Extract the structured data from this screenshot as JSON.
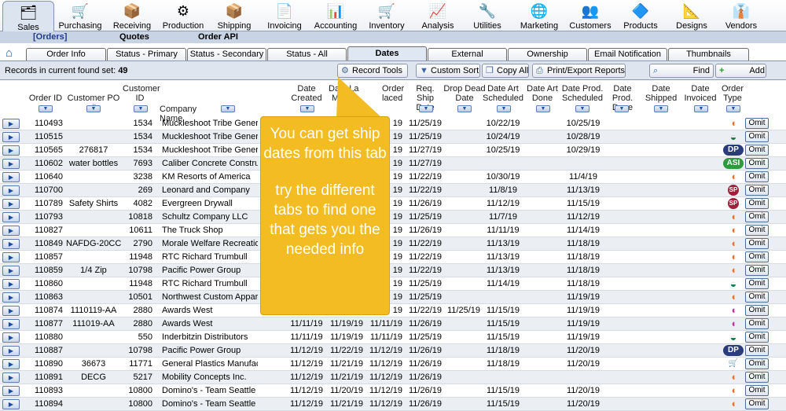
{
  "modules": [
    {
      "label": "Sales",
      "icon": "sales-icon",
      "glyph": "🗂"
    },
    {
      "label": "Purchasing",
      "icon": "purchasing-icon",
      "glyph": "🛒"
    },
    {
      "label": "Receiving",
      "icon": "receiving-icon",
      "glyph": "📦"
    },
    {
      "label": "Production",
      "icon": "production-icon",
      "glyph": "⚙"
    },
    {
      "label": "Shipping",
      "icon": "shipping-icon",
      "glyph": "📦"
    },
    {
      "label": "Invoicing",
      "icon": "invoicing-icon",
      "glyph": "📄"
    },
    {
      "label": "Accounting",
      "icon": "accounting-icon",
      "glyph": "📊"
    },
    {
      "label": "Inventory",
      "icon": "inventory-icon",
      "glyph": "🛒"
    },
    {
      "label": "Analysis",
      "icon": "analysis-icon",
      "glyph": "📈"
    },
    {
      "label": "Utilities",
      "icon": "utilities-icon",
      "glyph": "🔧"
    },
    {
      "label": "Marketing",
      "icon": "marketing-icon",
      "glyph": "🌐"
    },
    {
      "label": "Customers",
      "icon": "customers-icon",
      "glyph": "👥"
    },
    {
      "label": "Products",
      "icon": "products-icon",
      "glyph": "🔷"
    },
    {
      "label": "Designs",
      "icon": "designs-icon",
      "glyph": "📐"
    },
    {
      "label": "Vendors",
      "icon": "vendors-icon",
      "glyph": "👔"
    }
  ],
  "submenu": {
    "orders": "[Orders]",
    "quotes": "Quotes",
    "order_api": "Order API"
  },
  "tabs": [
    "Order Info",
    "Status - Primary",
    "Status - Secondary",
    "Status - All",
    "Dates",
    "External",
    "Ownership",
    "Email Notification",
    "Thumbnails"
  ],
  "records": {
    "label": "Records in current found set:",
    "count": "49"
  },
  "toolbar": {
    "record_tools": "Record Tools",
    "custom_sort": "Custom Sort",
    "copy_all": "Copy All",
    "print_export": "Print/Export Reports",
    "find": "Find",
    "add": "Add"
  },
  "columns": {
    "order_id": "Order ID",
    "customer_po": "Customer PO #",
    "customer_id_1": "Customer",
    "customer_id_2": "ID",
    "company_name": "Company Name",
    "date_created_1": "Date",
    "date_created_2": "Created",
    "last_mod_1": "Date La",
    "last_mod_2": "Modi",
    "order_placed_1": "Order",
    "order_placed_2": "laced",
    "req_ship_1": "Req. Ship",
    "req_ship_2": "Date",
    "drop_dead_1": "Drop Dead",
    "drop_dead_2": "Date",
    "art_sched_1": "Date Art",
    "art_sched_2": "Scheduled",
    "art_done_1": "Date Art",
    "art_done_2": "Done",
    "prod_sched_1": "Date Prod.",
    "prod_sched_2": "Scheduled",
    "prod_done_1": "Date Prod.",
    "prod_done_2": "Done",
    "shipped_1": "Date",
    "shipped_2": "Shipped",
    "invoiced_1": "Date",
    "invoiced_2": "Invoiced",
    "type_1": "Order",
    "type_2": "Type"
  },
  "rows": [
    {
      "order": "110493",
      "po": "",
      "cid": "1534",
      "company": "Muckleshoot Tribe General S",
      "created": "",
      "lastmod": "",
      "placed": "19",
      "reqship": "11/25/19",
      "dropdead": "",
      "artsched": "10/22/19",
      "artdone": "",
      "prodsched": "10/25/19",
      "type": "C",
      "type_color": "#e8702a"
    },
    {
      "order": "110515",
      "po": "",
      "cid": "1534",
      "company": "Muckleshoot Tribe General S",
      "created": "",
      "lastmod": "",
      "placed": "19",
      "reqship": "11/25/19",
      "dropdead": "",
      "artsched": "10/24/19",
      "artdone": "",
      "prodsched": "10/28/19",
      "type": "cap",
      "type_color": "#1e7a4a"
    },
    {
      "order": "110565",
      "po": "276817",
      "cid": "1534",
      "company": "Muckleshoot Tribe General S",
      "created": "",
      "lastmod": "",
      "placed": "19",
      "reqship": "11/27/19",
      "dropdead": "",
      "artsched": "10/25/19",
      "artdone": "",
      "prodsched": "10/29/19",
      "type": "DP",
      "type_color": "#2a3c7a"
    },
    {
      "order": "110602",
      "po": "water bottles",
      "cid": "7693",
      "company": "Caliber Concrete Constructio",
      "created": "",
      "lastmod": "",
      "placed": "19",
      "reqship": "11/27/19",
      "dropdead": "",
      "artsched": "",
      "artdone": "",
      "prodsched": "",
      "type": "ASI",
      "type_color": "#2f9a3c"
    },
    {
      "order": "110640",
      "po": "",
      "cid": "3238",
      "company": "KM Resorts of America",
      "created": "",
      "lastmod": "",
      "placed": "19",
      "reqship": "11/22/19",
      "dropdead": "",
      "artsched": "10/30/19",
      "artdone": "",
      "prodsched": "11/4/19",
      "type": "C",
      "type_color": "#e8702a"
    },
    {
      "order": "110700",
      "po": "",
      "cid": "269",
      "company": "Leonard and Company",
      "created": "",
      "lastmod": "",
      "placed": "19",
      "reqship": "11/22/19",
      "dropdead": "",
      "artsched": "11/8/19",
      "artdone": "",
      "prodsched": "11/13/19",
      "type": "SP",
      "type_color": "#a0203a"
    },
    {
      "order": "110789",
      "po": "Safety Shirts",
      "cid": "4082",
      "company": "Evergreen Drywall",
      "created": "",
      "lastmod": "",
      "placed": "19",
      "reqship": "11/26/19",
      "dropdead": "",
      "artsched": "11/12/19",
      "artdone": "",
      "prodsched": "11/15/19",
      "type": "SP",
      "type_color": "#a0203a"
    },
    {
      "order": "110793",
      "po": "",
      "cid": "10818",
      "company": "Schultz Company LLC",
      "created": "",
      "lastmod": "",
      "placed": "19",
      "reqship": "11/25/19",
      "dropdead": "",
      "artsched": "11/7/19",
      "artdone": "",
      "prodsched": "11/12/19",
      "type": "C",
      "type_color": "#e8702a"
    },
    {
      "order": "110827",
      "po": "",
      "cid": "10611",
      "company": "The Truck Shop",
      "created": "",
      "lastmod": "",
      "placed": "19",
      "reqship": "11/26/19",
      "dropdead": "",
      "artsched": "11/11/19",
      "artdone": "",
      "prodsched": "11/14/19",
      "type": "C",
      "type_color": "#e8702a"
    },
    {
      "order": "110849",
      "po": "NAFDG-20CC",
      "cid": "2790",
      "company": "Morale Welfare Recreation D",
      "created": "",
      "lastmod": "",
      "placed": "19",
      "reqship": "11/22/19",
      "dropdead": "",
      "artsched": "11/13/19",
      "artdone": "",
      "prodsched": "11/18/19",
      "type": "C",
      "type_color": "#e8702a"
    },
    {
      "order": "110857",
      "po": "",
      "cid": "11948",
      "company": "RTC Richard Trumbull",
      "created": "",
      "lastmod": "",
      "placed": "19",
      "reqship": "11/22/19",
      "dropdead": "",
      "artsched": "11/13/19",
      "artdone": "",
      "prodsched": "11/18/19",
      "type": "C",
      "type_color": "#e8702a"
    },
    {
      "order": "110859",
      "po": "1/4 Zip",
      "cid": "10798",
      "company": "Pacific Power Group",
      "created": "",
      "lastmod": "",
      "placed": "19",
      "reqship": "11/22/19",
      "dropdead": "",
      "artsched": "11/13/19",
      "artdone": "",
      "prodsched": "11/18/19",
      "type": "C",
      "type_color": "#e8702a"
    },
    {
      "order": "110860",
      "po": "",
      "cid": "11948",
      "company": "RTC Richard Trumbull",
      "created": "",
      "lastmod": "",
      "placed": "19",
      "reqship": "11/25/19",
      "dropdead": "",
      "artsched": "11/14/19",
      "artdone": "",
      "prodsched": "11/18/19",
      "type": "cap",
      "type_color": "#1e7a4a"
    },
    {
      "order": "110863",
      "po": "",
      "cid": "10501",
      "company": "Northwest Custom Apparel",
      "created": "",
      "lastmod": "",
      "placed": "19",
      "reqship": "11/25/19",
      "dropdead": "",
      "artsched": "",
      "artdone": "",
      "prodsched": "11/19/19",
      "type": "C",
      "type_color": "#e8702a"
    },
    {
      "order": "110874",
      "po": "1110119-AA",
      "cid": "2880",
      "company": "Awards West",
      "created": "",
      "lastmod": "",
      "placed": "19",
      "reqship": "11/22/19",
      "dropdead": "11/25/19",
      "artsched": "11/15/19",
      "artdone": "",
      "prodsched": "11/19/19",
      "type": "C",
      "type_color": "#b8369a"
    },
    {
      "order": "110877",
      "po": "111019-AA",
      "cid": "2880",
      "company": "Awards West",
      "created": "11/11/19",
      "lastmod": "11/19/19",
      "placed": "11/11/19",
      "reqship": "11/26/19",
      "dropdead": "",
      "artsched": "11/15/19",
      "artdone": "",
      "prodsched": "11/19/19",
      "type": "C",
      "type_color": "#b8369a"
    },
    {
      "order": "110880",
      "po": "",
      "cid": "550",
      "company": "Inderbitzin Distributors",
      "created": "11/11/19",
      "lastmod": "11/19/19",
      "placed": "11/11/19",
      "reqship": "11/25/19",
      "dropdead": "",
      "artsched": "11/15/19",
      "artdone": "",
      "prodsched": "11/19/19",
      "type": "cap",
      "type_color": "#1e7a4a"
    },
    {
      "order": "110887",
      "po": "",
      "cid": "10798",
      "company": "Pacific Power Group",
      "created": "11/12/19",
      "lastmod": "11/22/19",
      "placed": "11/12/19",
      "reqship": "11/26/19",
      "dropdead": "",
      "artsched": "11/18/19",
      "artdone": "",
      "prodsched": "11/20/19",
      "type": "DP",
      "type_color": "#2a3c7a"
    },
    {
      "order": "110890",
      "po": "36673",
      "cid": "11771",
      "company": "General Plastics Manufacturing",
      "created": "11/12/19",
      "lastmod": "11/21/19",
      "placed": "11/12/19",
      "reqship": "11/26/19",
      "dropdead": "",
      "artsched": "11/18/19",
      "artdone": "",
      "prodsched": "11/20/19",
      "type": "cart",
      "type_color": "#e8702a"
    },
    {
      "order": "110891",
      "po": "DECG",
      "cid": "5217",
      "company": "Mobility Concepts Inc.",
      "created": "11/12/19",
      "lastmod": "11/21/19",
      "placed": "11/12/19",
      "reqship": "11/26/19",
      "dropdead": "",
      "artsched": "",
      "artdone": "",
      "prodsched": "",
      "type": "C",
      "type_color": "#e8702a"
    },
    {
      "order": "110893",
      "po": "",
      "cid": "10800",
      "company": "Domino's - Team Seattle",
      "created": "11/12/19",
      "lastmod": "11/20/19",
      "placed": "11/12/19",
      "reqship": "11/26/19",
      "dropdead": "",
      "artsched": "11/15/19",
      "artdone": "",
      "prodsched": "11/20/19",
      "type": "C",
      "type_color": "#e8702a"
    },
    {
      "order": "110894",
      "po": "",
      "cid": "10800",
      "company": "Domino's - Team Seattle",
      "created": "11/12/19",
      "lastmod": "11/21/19",
      "placed": "11/12/19",
      "reqship": "11/26/19",
      "dropdead": "",
      "artsched": "11/15/19",
      "artdone": "",
      "prodsched": "11/20/19",
      "type": "C",
      "type_color": "#e8702a"
    }
  ],
  "omit_label": "Omit",
  "callout": {
    "line1": "You can get ship dates from this tab",
    "line2": "try the different tabs to find one that gets you the needed info"
  }
}
